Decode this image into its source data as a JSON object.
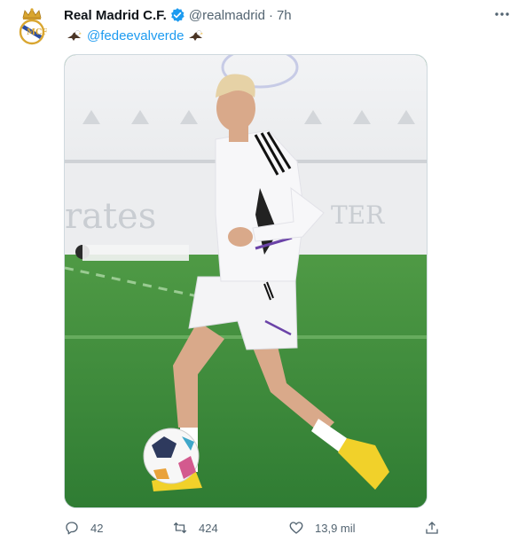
{
  "tweet": {
    "display_name": "Real Madrid C.F.",
    "handle": "@realmadrid",
    "separator": "·",
    "time": "7h",
    "mention": "@fedeevalverde",
    "emoji": "eagle-emoji",
    "avatar_icon": "real-madrid-crest",
    "verified_icon": "verified-badge-icon",
    "more_icon": "more-options-icon"
  },
  "actions": {
    "replies": "42",
    "retweets": "424",
    "likes": "13,9 mil"
  },
  "colors": {
    "accent": "#1d9bf0",
    "muted": "#536471",
    "text": "#0f1419",
    "crest_gold": "#d9a630",
    "crest_blue": "#2b4da1",
    "shoe_yellow": "#f1d12a"
  }
}
